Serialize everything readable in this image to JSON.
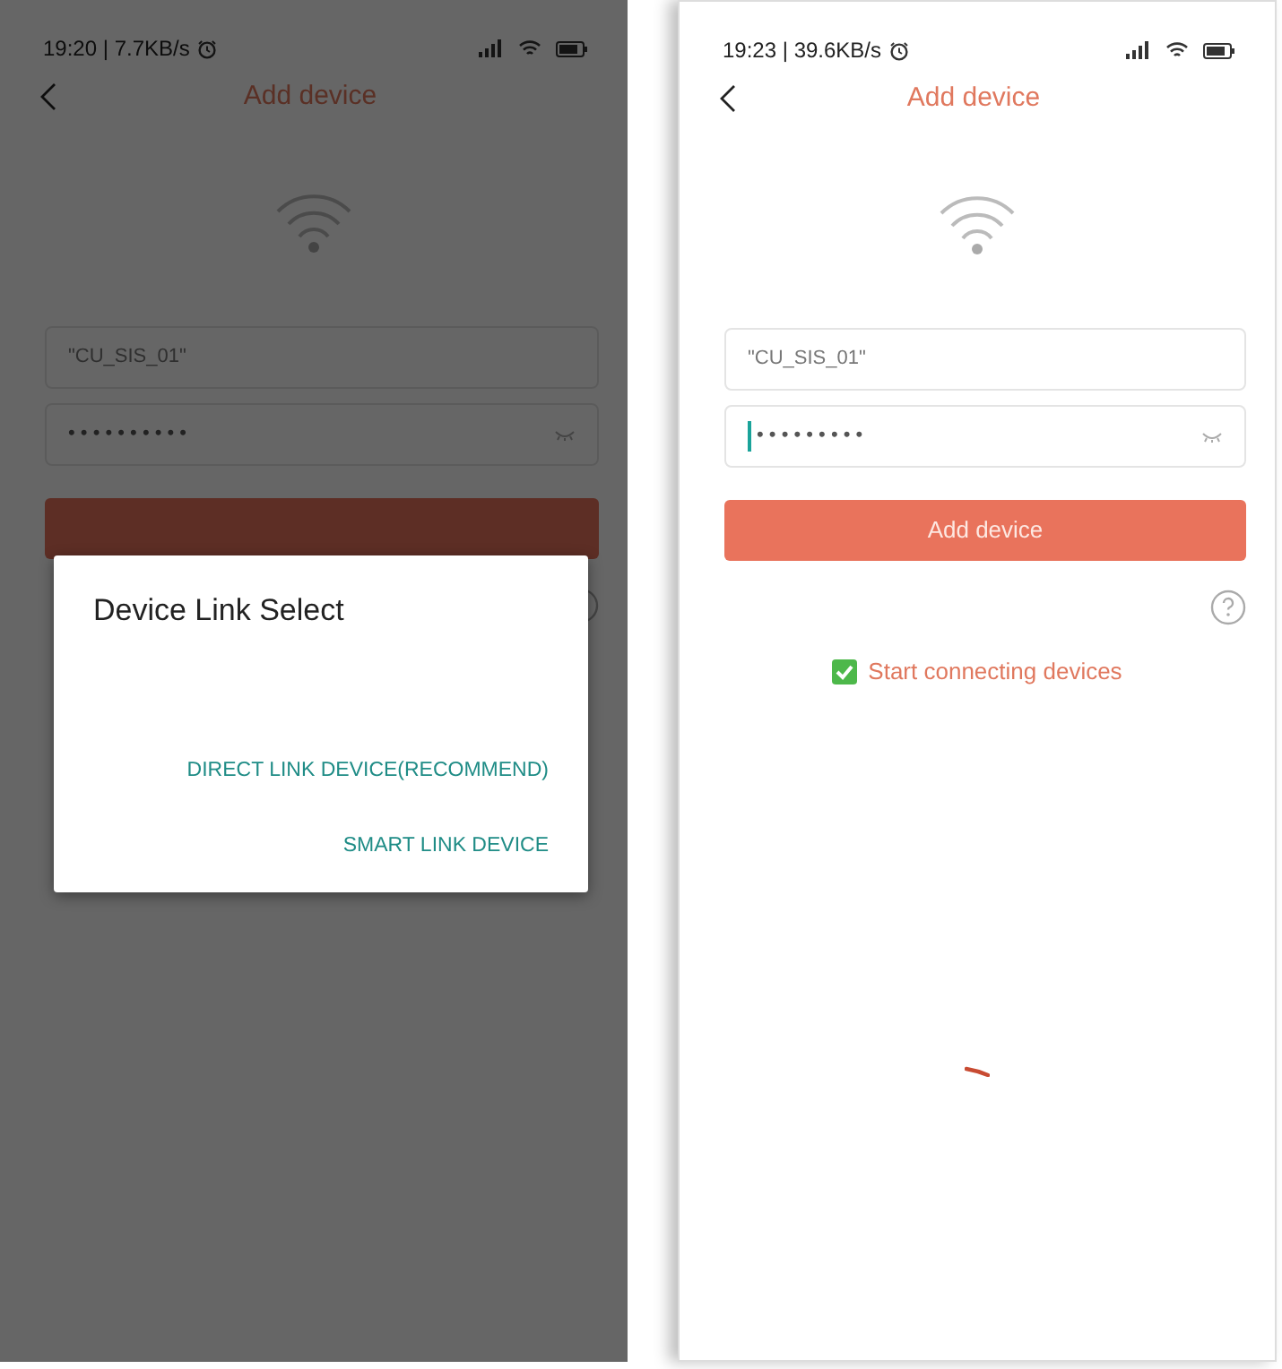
{
  "screens": [
    {
      "dimmed": true,
      "status_bar": {
        "time": "19:20 | 7.7KB/s"
      },
      "title": "Add device",
      "ssid": "\"CU_SIS_01\"",
      "password": "• • • • • • • • • •",
      "cursor": false,
      "dialog": {
        "title": "Device Link Select",
        "options": [
          "DIRECT LINK DEVICE(RECOMMEND)",
          "SMART LINK DEVICE"
        ]
      }
    },
    {
      "dimmed": false,
      "status_bar": {
        "time": "19:23 | 39.6KB/s"
      },
      "title": "Add device",
      "ssid": "\"CU_SIS_01\"",
      "password": "• • • • • • • • •",
      "cursor": true,
      "button": "Add device",
      "status": {
        "text": "Start connecting devices",
        "checked": true
      },
      "loading": true
    }
  ]
}
